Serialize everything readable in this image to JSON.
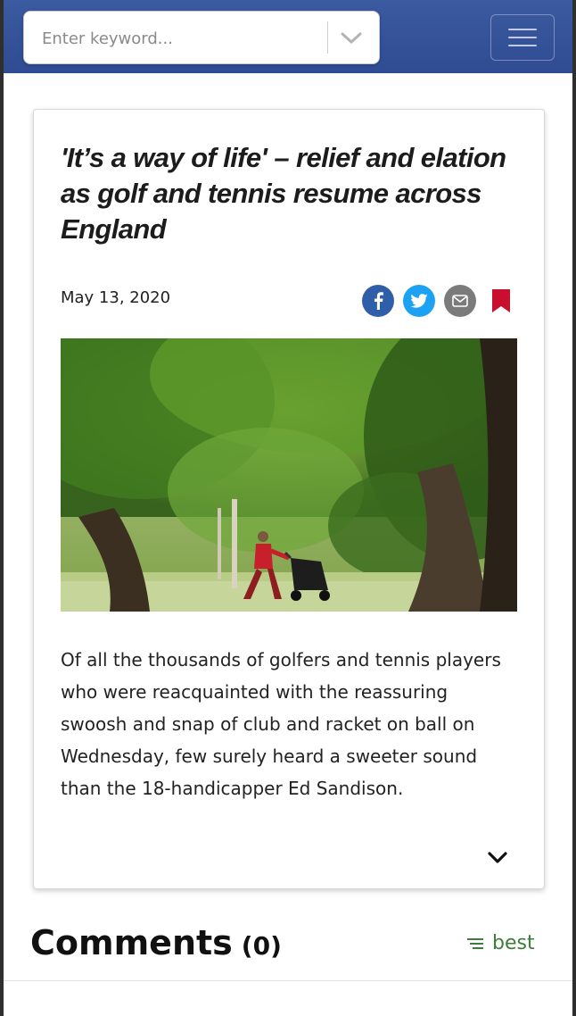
{
  "search": {
    "placeholder": "Enter keyword...",
    "value": ""
  },
  "article": {
    "headline": "'It’s a way of life' – relief and elation as golf and tennis resume across England",
    "date": "May 13, 2020",
    "body": "Of all the thousands of golfers and tennis players who were reacquainted with the reassuring swoosh and snap of club and racket on ball on Wednesday, few surely heard a sweeter sound than the 18-handicapper Ed Sandison."
  },
  "share": {
    "icons": [
      "facebook-icon",
      "twitter-icon",
      "email-icon",
      "bookmark-icon"
    ]
  },
  "comments": {
    "title": "Comments",
    "count": "(0)",
    "sort_label": "best"
  },
  "colors": {
    "header": "#3c5aa0",
    "facebook": "#2f5fa8",
    "twitter": "#1da1f2",
    "email": "#7b7b7b",
    "bookmark": "#c8102e",
    "sort": "#3b7f3b"
  }
}
